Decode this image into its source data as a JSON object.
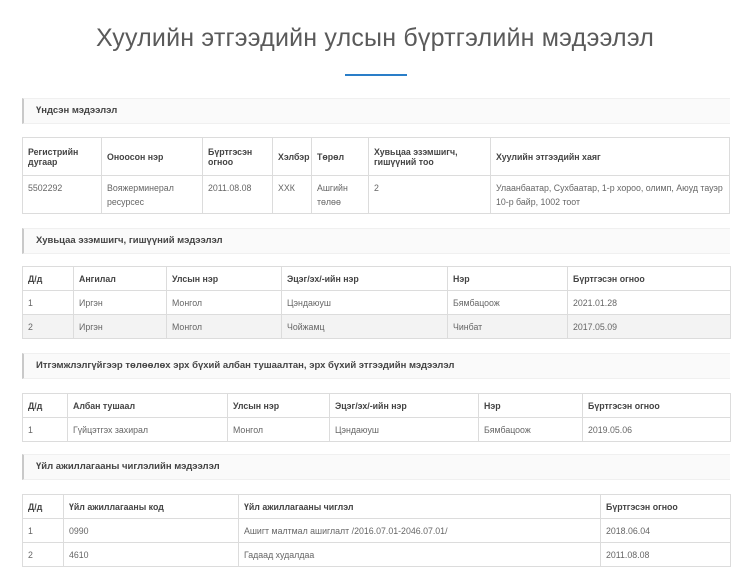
{
  "page": {
    "title": "Хуулийн этгээдийн улсын бүртгэлийн мэдээлэл"
  },
  "basic_info": {
    "heading": "Үндсэн мэдээлэл",
    "headers": [
      "Регистрийн дугаар",
      "Оноосон нэр",
      "Бүртгэсэн огноо",
      "Хэлбэр",
      "Төрөл",
      "Хувьцаа эзэмшигч, гишүүний тоо",
      "Хуулийн этгээдийн хаяг"
    ],
    "row": [
      "5502292",
      "Вояжерминерал ресурсес",
      "2011.08.08",
      "ХХК",
      "Ашгийн төлөө",
      "2",
      "Улаанбаатар, Сухбаатар, 1-р хороо, олимп, Аюуд тауэр 10-р байр, 1002 тоот"
    ]
  },
  "shareholders": {
    "heading": "Хувьцаа эзэмшигч, гишүүний мэдээлэл",
    "headers": [
      "Д/д",
      "Ангилал",
      "Улсын нэр",
      "Эцэг/эх/-ийн нэр",
      "Нэр",
      "Бүртгэсэн огноо"
    ],
    "rows": [
      [
        "1",
        "Иргэн",
        "Монгол",
        "Цэндаюуш",
        "Бямбацоож",
        "2021.01.28"
      ],
      [
        "2",
        "Иргэн",
        "Монгол",
        "Чойжамц",
        "Чинбат",
        "2017.05.09"
      ]
    ]
  },
  "officials": {
    "heading": "Итгэмжлэлгүйгээр төлөөлөх эрх бүхий албан тушаалтан, эрх бүхий этгээдийн мэдээлэл",
    "headers": [
      "Д/д",
      "Албан тушаал",
      "Улсын нэр",
      "Эцэг/эх/-ийн нэр",
      "Нэр",
      "Бүртгэсэн огноо"
    ],
    "rows": [
      [
        "1",
        "Гүйцэтгэх захирал",
        "Монгол",
        "Цэндаюуш",
        "Бямбацоож",
        "2019.05.06"
      ]
    ]
  },
  "activities": {
    "heading": "Үйл ажиллагааны чиглэлийн мэдээлэл",
    "headers": [
      "Д/д",
      "Үйл ажиллагааны код",
      "Үйл ажиллагааны чиглэл",
      "Бүртгэсэн огноо"
    ],
    "rows": [
      [
        "1",
        "0990",
        "Ашигт малтмал ашиглалт /2016.07.01-2046.07.01/",
        "2018.06.04"
      ],
      [
        "2",
        "4610",
        "Гадаад худалдаа",
        "2011.08.08"
      ]
    ]
  }
}
